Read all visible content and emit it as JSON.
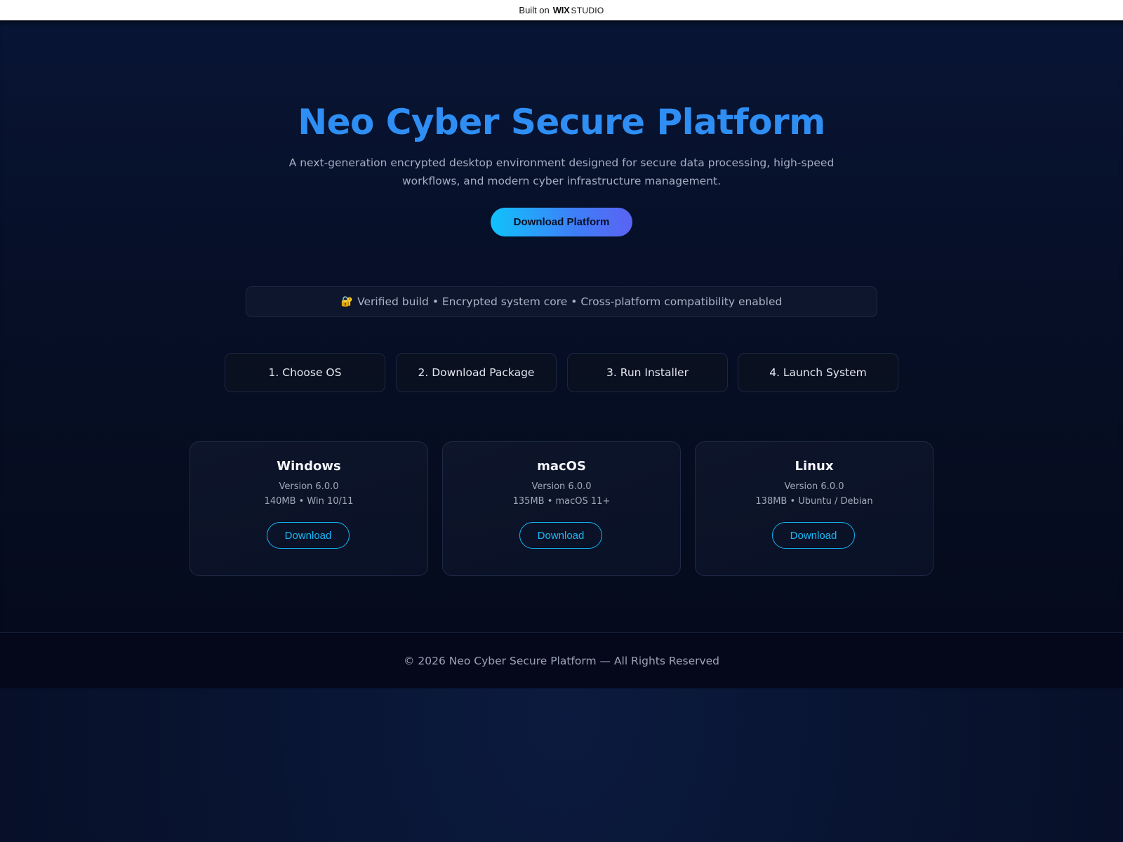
{
  "banner": {
    "prefix": "Built on",
    "brand_bold": "WIX",
    "brand_light": "STUDIO"
  },
  "hero": {
    "title": "Neo Cyber Secure Platform",
    "subtitle": "A next-generation encrypted desktop environment designed for secure data processing, high-speed workflows, and modern cyber infrastructure management.",
    "cta_label": "Download Platform"
  },
  "notice": {
    "icon": "lock-key-icon",
    "icon_glyph": "🔐",
    "text": "Verified build • Encrypted system core • Cross-platform compatibility enabled"
  },
  "steps": [
    {
      "label": "1. Choose OS"
    },
    {
      "label": "2. Download Package"
    },
    {
      "label": "3. Run Installer"
    },
    {
      "label": "4. Launch System"
    }
  ],
  "platforms": [
    {
      "name": "Windows",
      "version": "Version 6.0.0",
      "meta": "140MB • Win 10/11",
      "button": "Download"
    },
    {
      "name": "macOS",
      "version": "Version 6.0.0",
      "meta": "135MB • macOS 11+",
      "button": "Download"
    },
    {
      "name": "Linux",
      "version": "Version 6.0.0",
      "meta": "138MB • Ubuntu / Debian",
      "button": "Download"
    }
  ],
  "footer": {
    "text": "© 2026 Neo Cyber Secure Platform — All Rights Reserved"
  },
  "colors": {
    "title_blue": "#2f8ef3",
    "accent_cyan": "#18b8f5",
    "background_navy": "#071029"
  }
}
